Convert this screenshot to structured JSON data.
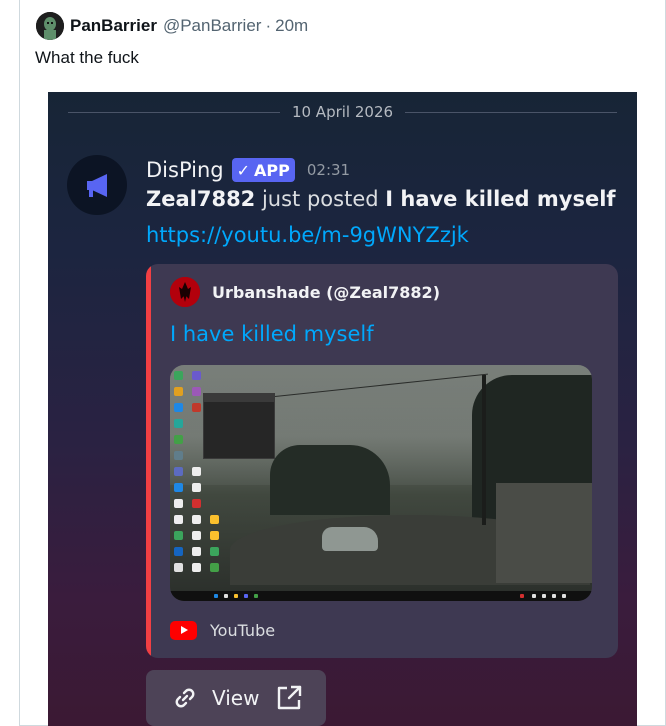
{
  "tweet": {
    "display_name": "PanBarrier",
    "handle": "@PanBarrier",
    "separator": "·",
    "time": "20m",
    "text": "What the fuck"
  },
  "discord": {
    "date_divider": "10 April 2026",
    "bot": {
      "name": "DisPing",
      "badge": "APP",
      "badge_check": "✓",
      "timestamp": "02:31",
      "avatar_icon": "megaphone-icon"
    },
    "message": {
      "user": "Zeal7882",
      "middle": " just posted ",
      "video_title": "I have killed myself",
      "link": "https://youtu.be/m-9gWNYZzjk"
    },
    "embed": {
      "author": "Urbanshade (@Zeal7882)",
      "title": "I have killed myself",
      "provider": "YouTube",
      "accent_color": "#f23f43"
    },
    "view_button": {
      "label": "View"
    }
  }
}
